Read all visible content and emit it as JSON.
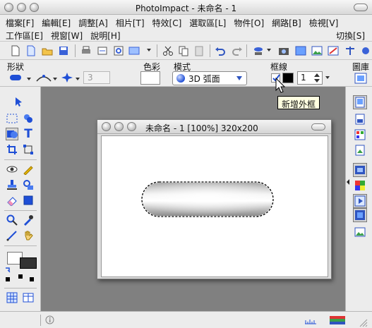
{
  "window": {
    "title": "PhotoImpact - 未命名 - 1"
  },
  "menu": {
    "row1": [
      "檔案[F]",
      "編輯[E]",
      "調整[A]",
      "相片[T]",
      "特效[C]",
      "選取區[L]",
      "物件[O]",
      "網路[B]",
      "檢視[V]"
    ],
    "row2": [
      "工作區[E]",
      "視窗[W]",
      "說明[H]"
    ],
    "switch": "切換[S]"
  },
  "toolbar": {
    "icons": [
      "new-icon",
      "open-icon",
      "open-folder-icon",
      "save-icon",
      "print-icon",
      "scan-icon",
      "print-preview-icon",
      "capture-icon",
      "cut-icon",
      "copy-icon",
      "paste-icon",
      "undo-icon",
      "redo-icon",
      "paint-bucket-icon",
      "camera-icon",
      "photo-icon",
      "image-icon",
      "scale-icon",
      "more-icon"
    ]
  },
  "attributes": {
    "shape_label": "形狀",
    "color_label": "色彩",
    "mode_label": "模式",
    "mode_value": "3D 弧面",
    "border_label": "框線",
    "border_checked": true,
    "border_width": "1",
    "gallery_label": "圖庫",
    "stepper_value": "3",
    "fill_color": "#ffffff",
    "border_color": "#000000",
    "accent": "#3a62d8"
  },
  "tooltip": "新增外框",
  "document": {
    "title": "未命名 - 1 [100%] 320x200"
  },
  "tools": {
    "left": [
      "pointer-icon",
      "marquee-icon",
      "lasso-icon",
      "shape-tool-icon",
      "text-tool-icon",
      "crop-icon",
      "transform-icon",
      "redeye-icon",
      "brush-icon",
      "stamp-icon",
      "retouch-icon",
      "eraser-icon",
      "fill-icon",
      "zoom-icon",
      "eyedropper-icon",
      "path-icon",
      "hand-icon",
      "grid-icon",
      "table-icon"
    ],
    "right": [
      "layers-panel-icon",
      "objects-panel-icon",
      "palette-panel-icon",
      "preview-panel-icon",
      "gallery-panel-icon",
      "browser-panel-icon",
      "anim-panel-icon",
      "filmstrip-icon",
      "image-panel-icon"
    ]
  },
  "status": {
    "info_icon": "info-icon"
  }
}
